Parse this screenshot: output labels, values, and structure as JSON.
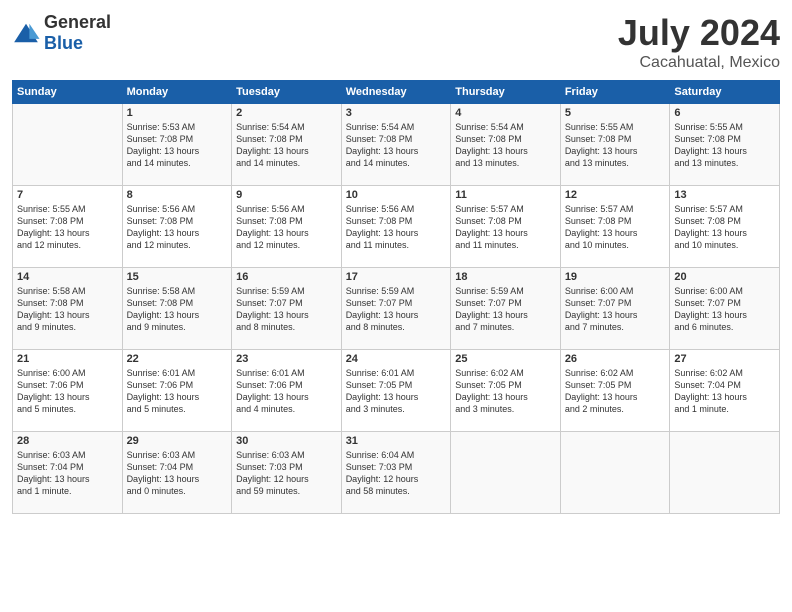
{
  "logo": {
    "general": "General",
    "blue": "Blue"
  },
  "title": "July 2024",
  "location": "Cacahuatal, Mexico",
  "days_header": [
    "Sunday",
    "Monday",
    "Tuesday",
    "Wednesday",
    "Thursday",
    "Friday",
    "Saturday"
  ],
  "weeks": [
    [
      {
        "day": "",
        "info": ""
      },
      {
        "day": "1",
        "info": "Sunrise: 5:53 AM\nSunset: 7:08 PM\nDaylight: 13 hours\nand 14 minutes."
      },
      {
        "day": "2",
        "info": "Sunrise: 5:54 AM\nSunset: 7:08 PM\nDaylight: 13 hours\nand 14 minutes."
      },
      {
        "day": "3",
        "info": "Sunrise: 5:54 AM\nSunset: 7:08 PM\nDaylight: 13 hours\nand 14 minutes."
      },
      {
        "day": "4",
        "info": "Sunrise: 5:54 AM\nSunset: 7:08 PM\nDaylight: 13 hours\nand 13 minutes."
      },
      {
        "day": "5",
        "info": "Sunrise: 5:55 AM\nSunset: 7:08 PM\nDaylight: 13 hours\nand 13 minutes."
      },
      {
        "day": "6",
        "info": "Sunrise: 5:55 AM\nSunset: 7:08 PM\nDaylight: 13 hours\nand 13 minutes."
      }
    ],
    [
      {
        "day": "7",
        "info": "Sunrise: 5:55 AM\nSunset: 7:08 PM\nDaylight: 13 hours\nand 12 minutes."
      },
      {
        "day": "8",
        "info": "Sunrise: 5:56 AM\nSunset: 7:08 PM\nDaylight: 13 hours\nand 12 minutes."
      },
      {
        "day": "9",
        "info": "Sunrise: 5:56 AM\nSunset: 7:08 PM\nDaylight: 13 hours\nand 12 minutes."
      },
      {
        "day": "10",
        "info": "Sunrise: 5:56 AM\nSunset: 7:08 PM\nDaylight: 13 hours\nand 11 minutes."
      },
      {
        "day": "11",
        "info": "Sunrise: 5:57 AM\nSunset: 7:08 PM\nDaylight: 13 hours\nand 11 minutes."
      },
      {
        "day": "12",
        "info": "Sunrise: 5:57 AM\nSunset: 7:08 PM\nDaylight: 13 hours\nand 10 minutes."
      },
      {
        "day": "13",
        "info": "Sunrise: 5:57 AM\nSunset: 7:08 PM\nDaylight: 13 hours\nand 10 minutes."
      }
    ],
    [
      {
        "day": "14",
        "info": "Sunrise: 5:58 AM\nSunset: 7:08 PM\nDaylight: 13 hours\nand 9 minutes."
      },
      {
        "day": "15",
        "info": "Sunrise: 5:58 AM\nSunset: 7:08 PM\nDaylight: 13 hours\nand 9 minutes."
      },
      {
        "day": "16",
        "info": "Sunrise: 5:59 AM\nSunset: 7:07 PM\nDaylight: 13 hours\nand 8 minutes."
      },
      {
        "day": "17",
        "info": "Sunrise: 5:59 AM\nSunset: 7:07 PM\nDaylight: 13 hours\nand 8 minutes."
      },
      {
        "day": "18",
        "info": "Sunrise: 5:59 AM\nSunset: 7:07 PM\nDaylight: 13 hours\nand 7 minutes."
      },
      {
        "day": "19",
        "info": "Sunrise: 6:00 AM\nSunset: 7:07 PM\nDaylight: 13 hours\nand 7 minutes."
      },
      {
        "day": "20",
        "info": "Sunrise: 6:00 AM\nSunset: 7:07 PM\nDaylight: 13 hours\nand 6 minutes."
      }
    ],
    [
      {
        "day": "21",
        "info": "Sunrise: 6:00 AM\nSunset: 7:06 PM\nDaylight: 13 hours\nand 5 minutes."
      },
      {
        "day": "22",
        "info": "Sunrise: 6:01 AM\nSunset: 7:06 PM\nDaylight: 13 hours\nand 5 minutes."
      },
      {
        "day": "23",
        "info": "Sunrise: 6:01 AM\nSunset: 7:06 PM\nDaylight: 13 hours\nand 4 minutes."
      },
      {
        "day": "24",
        "info": "Sunrise: 6:01 AM\nSunset: 7:05 PM\nDaylight: 13 hours\nand 3 minutes."
      },
      {
        "day": "25",
        "info": "Sunrise: 6:02 AM\nSunset: 7:05 PM\nDaylight: 13 hours\nand 3 minutes."
      },
      {
        "day": "26",
        "info": "Sunrise: 6:02 AM\nSunset: 7:05 PM\nDaylight: 13 hours\nand 2 minutes."
      },
      {
        "day": "27",
        "info": "Sunrise: 6:02 AM\nSunset: 7:04 PM\nDaylight: 13 hours\nand 1 minute."
      }
    ],
    [
      {
        "day": "28",
        "info": "Sunrise: 6:03 AM\nSunset: 7:04 PM\nDaylight: 13 hours\nand 1 minute."
      },
      {
        "day": "29",
        "info": "Sunrise: 6:03 AM\nSunset: 7:04 PM\nDaylight: 13 hours\nand 0 minutes."
      },
      {
        "day": "30",
        "info": "Sunrise: 6:03 AM\nSunset: 7:03 PM\nDaylight: 12 hours\nand 59 minutes."
      },
      {
        "day": "31",
        "info": "Sunrise: 6:04 AM\nSunset: 7:03 PM\nDaylight: 12 hours\nand 58 minutes."
      },
      {
        "day": "",
        "info": ""
      },
      {
        "day": "",
        "info": ""
      },
      {
        "day": "",
        "info": ""
      }
    ]
  ]
}
